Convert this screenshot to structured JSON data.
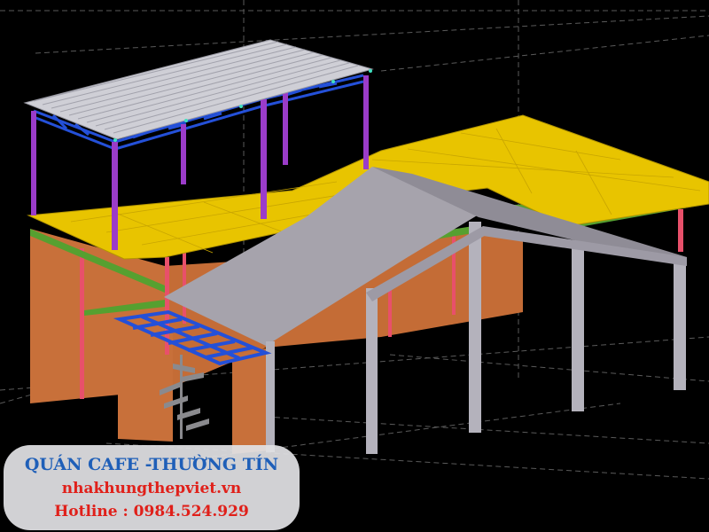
{
  "caption": {
    "title": "QUÁN CAFE -THƯỜNG TÍN",
    "website": "nhakhungthepviet.vn",
    "hotline": "Hotline : 0984.524.929"
  },
  "colors": {
    "background": "#000000",
    "upper_floor": "#e8c400",
    "wall": "#c8703a",
    "roof_main": "#a6a3ac",
    "roof_upper": "#cfcfd6",
    "truss_blue": "#2450d8",
    "column_purple": "#9b3cc9",
    "column_grey": "#b4b2bc",
    "column_pink": "#e8506a",
    "beam_green": "#56a030",
    "caption_title": "#1f5fb8",
    "caption_red": "#e0201a"
  },
  "icons": {
    "staircase": "spiral-staircase-icon"
  }
}
